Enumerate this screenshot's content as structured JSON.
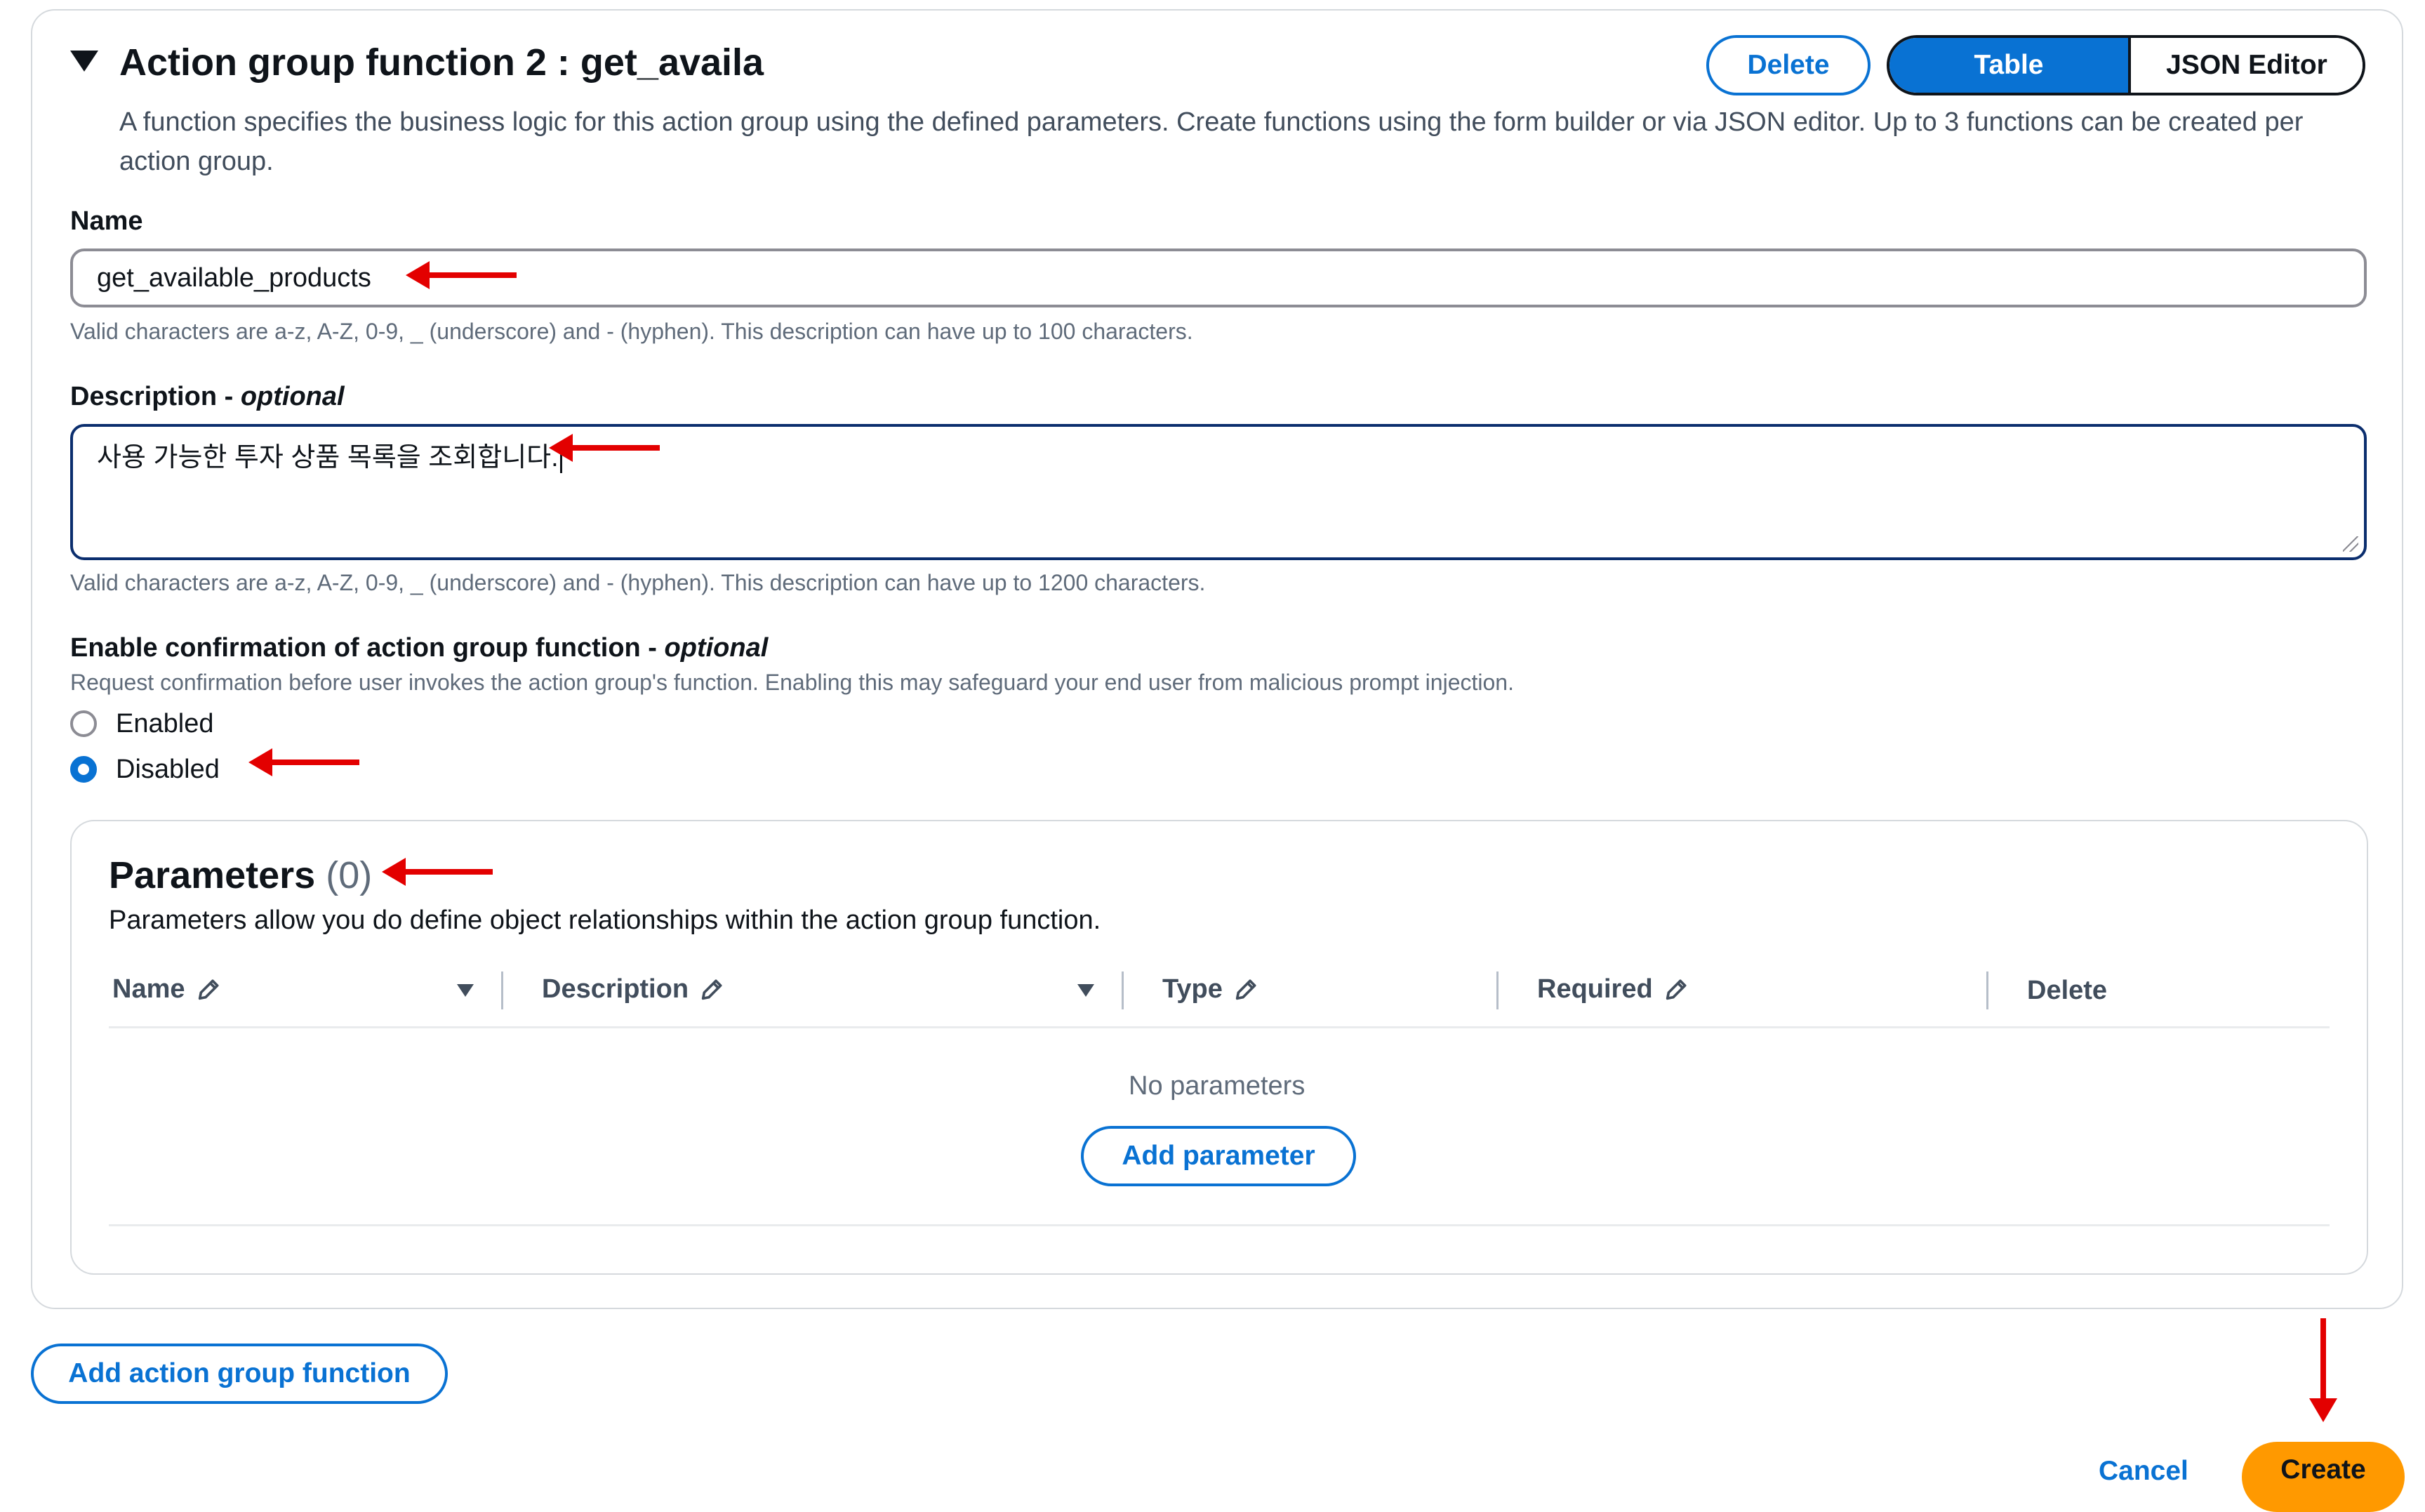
{
  "function_section": {
    "title": "Action group function 2 : get_availa",
    "description": "A function specifies the business logic for this action group using the defined parameters. Create functions using the form builder or via JSON editor. Up to 3 functions can be created per action group.",
    "delete_label": "Delete",
    "view_modes": {
      "table": "Table",
      "json": "JSON Editor",
      "selected": "Table"
    }
  },
  "name_field": {
    "label": "Name",
    "value": "get_available_products",
    "hint": "Valid characters are a-z, A-Z, 0-9, _ (underscore) and - (hyphen). This description can have up to 100 characters."
  },
  "description_field": {
    "label": "Description - ",
    "label_optional": "optional",
    "value": "사용 가능한 투자 상품 목록을 조회합니다.",
    "hint": "Valid characters are a-z, A-Z, 0-9, _ (underscore) and - (hyphen). This description can have up to 1200 characters."
  },
  "confirmation": {
    "label": "Enable confirmation of action group function - ",
    "label_optional": "optional",
    "description": "Request confirmation before user invokes the action group's function. Enabling this may safeguard your end user from malicious prompt injection.",
    "options": [
      {
        "label": "Enabled",
        "selected": false
      },
      {
        "label": "Disabled",
        "selected": true
      }
    ]
  },
  "parameters": {
    "title": "Parameters",
    "count": "(0)",
    "description": "Parameters allow you do define object relationships within the action group function.",
    "columns": [
      "Name",
      "Description",
      "Type",
      "Required",
      "Delete"
    ],
    "empty_text": "No parameters",
    "add_label": "Add parameter"
  },
  "footer": {
    "add_function_label": "Add action group function",
    "cancel_label": "Cancel",
    "create_label": "Create"
  },
  "colors": {
    "primary": "#0972d3",
    "create_button": "#ff9900",
    "annotation_arrow": "#e30000"
  }
}
